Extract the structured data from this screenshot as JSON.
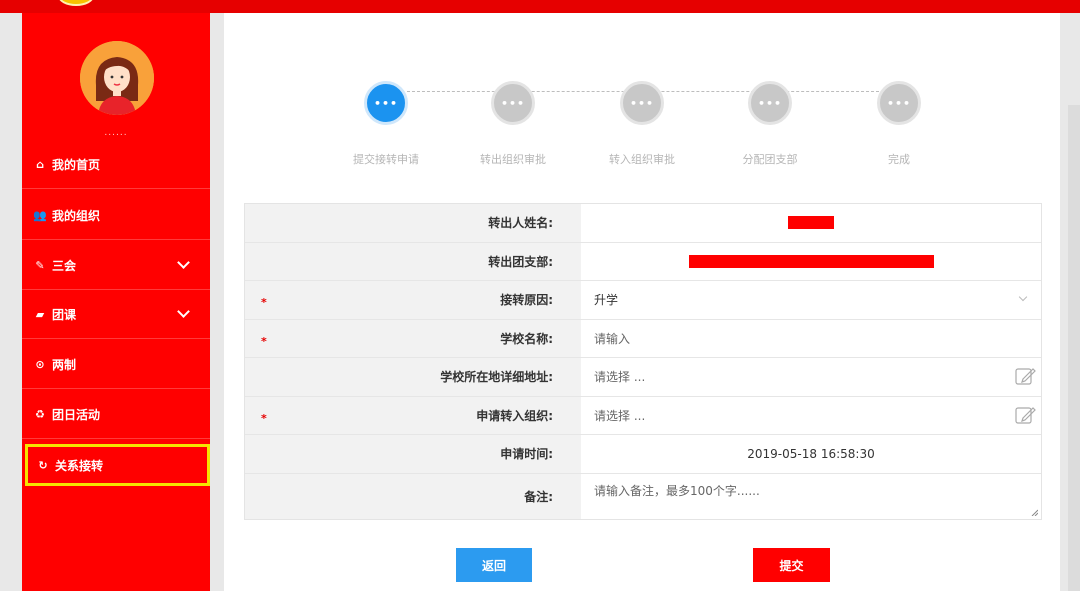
{
  "sidebar": {
    "user_name": "......",
    "items": [
      {
        "icon": "home-icon",
        "glyph": "⌂",
        "label": "我的首页"
      },
      {
        "icon": "users-icon",
        "glyph": "👥",
        "label": "我的组织"
      },
      {
        "icon": "edit-square-icon",
        "glyph": "✎",
        "label": "三会"
      },
      {
        "icon": "folder-open-icon",
        "glyph": "▰",
        "label": "团课"
      },
      {
        "icon": "circle-dot-icon",
        "glyph": "⊙",
        "label": "两制"
      },
      {
        "icon": "recycle-icon",
        "glyph": "♻",
        "label": "团日活动"
      },
      {
        "icon": "refresh-icon",
        "glyph": "↻",
        "label": "关系接转"
      }
    ]
  },
  "steps": [
    {
      "label": "提交接转申请",
      "icon": "•••"
    },
    {
      "label": "转出组织审批",
      "icon": "•••"
    },
    {
      "label": "转入组织审批",
      "icon": "•••"
    },
    {
      "label": "分配团支部",
      "icon": "•••"
    },
    {
      "label": "完成",
      "icon": "•••"
    }
  ],
  "form": {
    "out_name_label": "转出人姓名:",
    "out_branch_label": "转出团支部:",
    "reason_label": "接转原因:",
    "reason_value": "升学",
    "school_label": "学校名称:",
    "school_placeholder": "请输入",
    "address_label": "学校所在地详细地址:",
    "address_placeholder": "请选择 ...",
    "org_label": "申请转入组织:",
    "org_placeholder": "请选择 ...",
    "time_label": "申请时间:",
    "time_value": "2019-05-18 16:58:30",
    "remark_label": "备注:",
    "remark_placeholder": "请输入备注，最多100个字......",
    "required_mark": "*"
  },
  "buttons": {
    "back": "返回",
    "submit": "提交"
  },
  "colors": {
    "primary_red": "#ff0000",
    "active_step": "#1b93f0",
    "highlight_border": "#f5e400",
    "back_button": "#2c9bf0"
  }
}
